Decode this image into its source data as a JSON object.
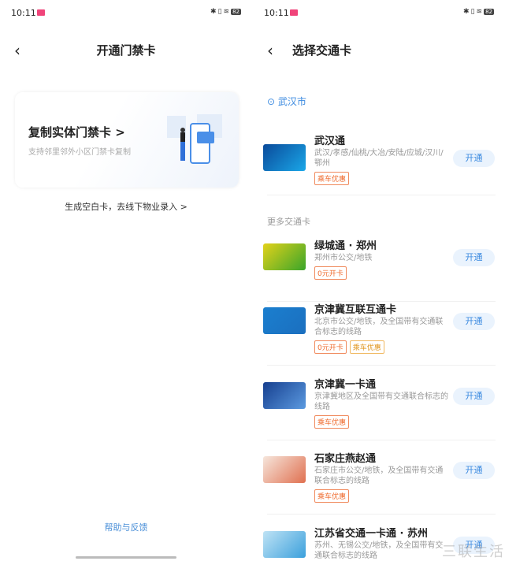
{
  "status": {
    "time": "10:11",
    "battery": "82"
  },
  "left": {
    "title": "开通门禁卡",
    "copy_card": {
      "heading": "复制实体门禁卡 >",
      "sub": "支持邻里邻外小区门禁卡复制"
    },
    "blank_card_link": "生成空白卡，去线下物业录入 >",
    "help": "帮助与反馈"
  },
  "right": {
    "title": "选择交通卡",
    "location": "武汉市",
    "more_section": "更多交通卡",
    "open_label": "开通",
    "cards": [
      {
        "name": "武汉通",
        "desc": "武汉/孝感/仙桃/大冶/安陆/应城/汉川/鄂州",
        "tags": [
          "乘车优惠"
        ],
        "colors": [
          "#0a4a9a",
          "#1aa7e8"
        ]
      },
      {
        "name": "绿城通 · 郑州",
        "desc": "郑州市公交/地铁",
        "tags": [
          "0元开卡"
        ],
        "colors": [
          "#e3d21a",
          "#3aa52a"
        ]
      },
      {
        "name": "京津冀互联互通卡",
        "desc": "北京市公交/地铁，及全国带有交通联合标志的线路",
        "tags": [
          "0元开卡",
          "乘车优惠"
        ],
        "colors": [
          "#1b7fcf",
          "#1b6fbf"
        ]
      },
      {
        "name": "京津冀一卡通",
        "desc": "京津冀地区及全国带有交通联合标志的线路",
        "tags": [
          "乘车优惠"
        ],
        "colors": [
          "#163f8f",
          "#5b9ae0"
        ]
      },
      {
        "name": "石家庄燕赵通",
        "desc": "石家庄市公交/地铁，及全国带有交通联合标志的线路",
        "tags": [
          "乘车优惠"
        ],
        "colors": [
          "#f6e6dc",
          "#e07050"
        ]
      },
      {
        "name": "江苏省交通一卡通 · 苏州",
        "desc": "苏州、无锡公交/地铁，及全国带有交通联合标志的线路",
        "tags": [],
        "colors": [
          "#bfe3f5",
          "#3ba0dc"
        ]
      }
    ]
  },
  "watermark": "三联生活"
}
